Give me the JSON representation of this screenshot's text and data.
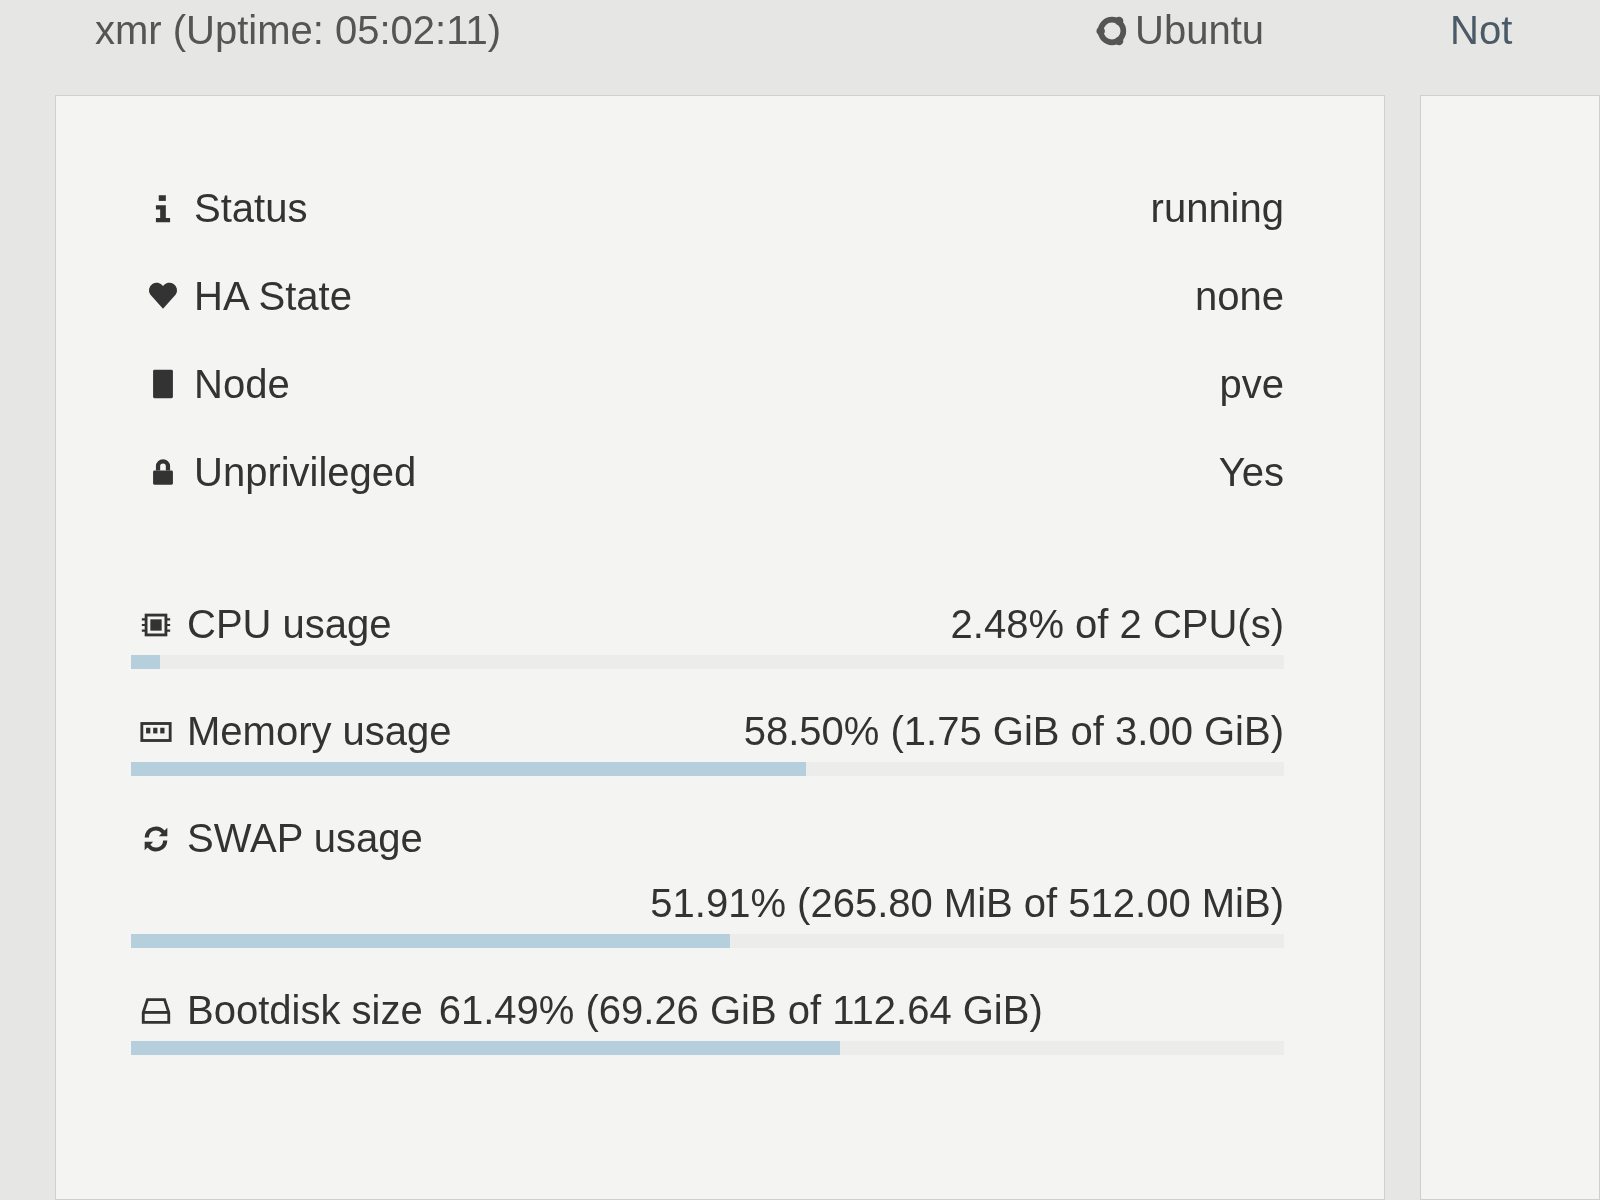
{
  "header": {
    "title": "xmr (Uptime: 05:02:11)",
    "os": "Ubuntu",
    "next_tab": "Not"
  },
  "info_rows": [
    {
      "label": "Status",
      "value": "running"
    },
    {
      "label": "HA State",
      "value": "none"
    },
    {
      "label": "Node",
      "value": "pve"
    },
    {
      "label": "Unprivileged",
      "value": "Yes"
    }
  ],
  "meters": [
    {
      "kind": "inline",
      "label": "CPU usage",
      "value": "2.48% of 2 CPU(s)",
      "level": 0.0248
    },
    {
      "kind": "inline",
      "label": "Memory usage",
      "value": "58.50% (1.75 GiB of 3.00 GiB)",
      "level": 0.585
    },
    {
      "kind": "wrapped",
      "label": "SWAP usage",
      "value": "51.91% (265.80 MiB of 512.00 MiB)",
      "level": 0.5191
    },
    {
      "kind": "adjacent",
      "label": "Bootdisk size",
      "value": "61.49% (69.26 GiB of 112.64 GiB)",
      "level": 0.6149
    }
  ]
}
